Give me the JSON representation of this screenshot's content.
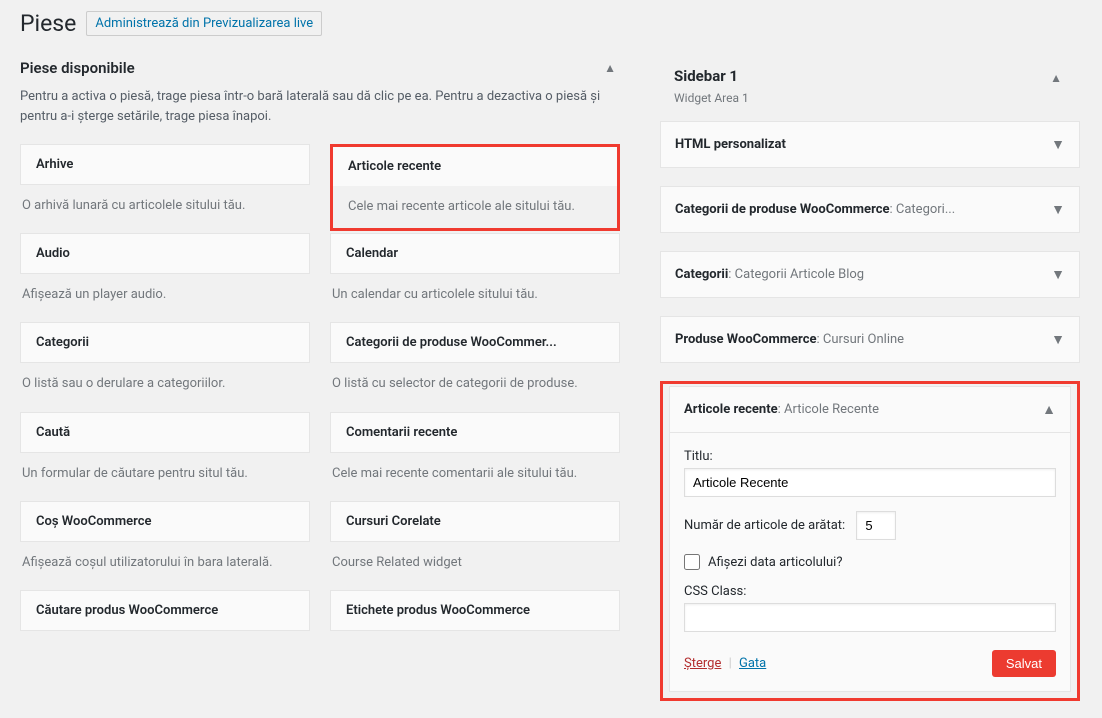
{
  "header": {
    "title": "Piese",
    "live_link": "Administrează din Previzualizarea live"
  },
  "available": {
    "title": "Piese disponibile",
    "description": "Pentru a activa o piesă, trage piesa într-o bară laterală sau dă clic pe ea. Pentru a dezactiva o piesă și pentru a-i șterge setările, trage piesa înapoi.",
    "widgets": [
      {
        "title": "Arhive",
        "desc": "O arhivă lunară cu articolele sitului tău."
      },
      {
        "title": "Articole recente",
        "desc": "Cele mai recente articole ale sitului tău."
      },
      {
        "title": "Audio",
        "desc": "Afișează un player audio."
      },
      {
        "title": "Calendar",
        "desc": "Un calendar cu articolele sitului tău."
      },
      {
        "title": "Categorii",
        "desc": "O listă sau o derulare a categoriilor."
      },
      {
        "title": "Categorii de produse WooCommer...",
        "desc": "O listă cu selector de categorii de produse."
      },
      {
        "title": "Caută",
        "desc": "Un formular de căutare pentru situl tău."
      },
      {
        "title": "Comentarii recente",
        "desc": "Cele mai recente comentarii ale sitului tău."
      },
      {
        "title": "Coș WooCommerce",
        "desc": "Afișează coșul utilizatorului în bara laterală."
      },
      {
        "title": "Cursuri Corelate",
        "desc": "Course Related widget"
      },
      {
        "title": "Căutare produs WooCommerce",
        "desc": ""
      },
      {
        "title": "Etichete produs WooCommerce",
        "desc": ""
      }
    ]
  },
  "sidebar": {
    "title": "Sidebar 1",
    "subtitle": "Widget Area 1",
    "widgets": [
      {
        "title_a": "HTML personalizat",
        "title_b": ""
      },
      {
        "title_a": "Categorii de produse WooCommerce",
        "title_b": ": Categori..."
      },
      {
        "title_a": "Categorii",
        "title_b": ": Categorii Articole Blog"
      },
      {
        "title_a": "Produse WooCommerce",
        "title_b": ": Cursuri Online"
      }
    ],
    "open_widget": {
      "title_a": "Articole recente",
      "title_b": ": Articole Recente",
      "form": {
        "title_label": "Titlu:",
        "title_value": "Articole Recente",
        "count_label": "Număr de articole de arătat:",
        "count_value": "5",
        "showdate_label": "Afișezi data articolului?",
        "cssclass_label": "CSS Class:",
        "cssclass_value": ""
      },
      "actions": {
        "delete": "Șterge",
        "done": "Gata",
        "saved": "Salvat"
      }
    }
  }
}
